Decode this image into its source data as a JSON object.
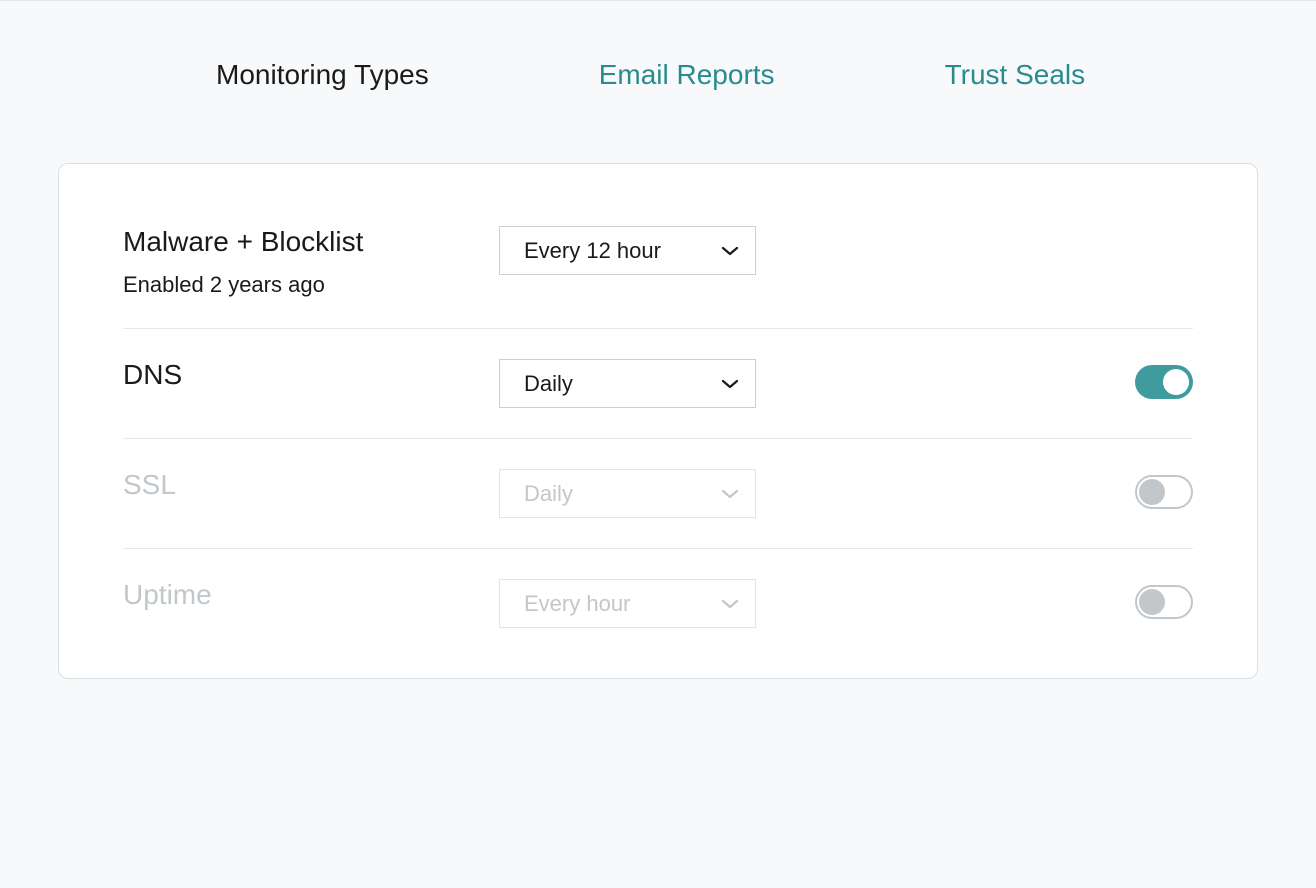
{
  "tabs": {
    "monitoring": "Monitoring Types",
    "email": "Email Reports",
    "trust": "Trust Seals"
  },
  "rows": {
    "malware": {
      "title": "Malware + Blocklist",
      "subtitle": "Enabled 2 years ago",
      "frequency": "Every 12 hour"
    },
    "dns": {
      "title": "DNS",
      "frequency": "Daily"
    },
    "ssl": {
      "title": "SSL",
      "frequency": "Daily"
    },
    "uptime": {
      "title": "Uptime",
      "frequency": "Every hour"
    }
  }
}
